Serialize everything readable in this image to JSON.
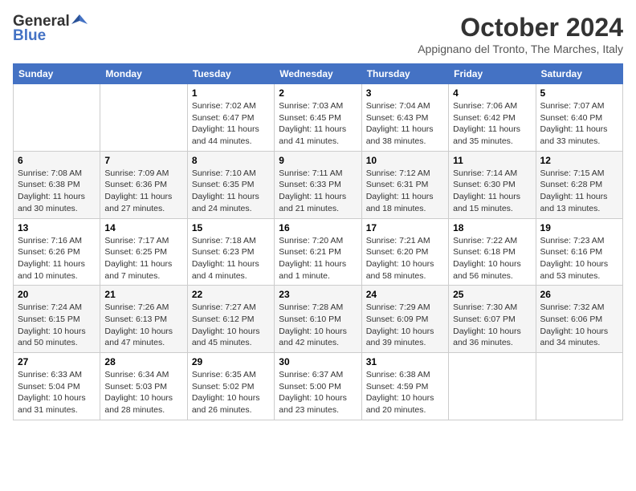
{
  "logo": {
    "general": "General",
    "blue": "Blue"
  },
  "header": {
    "month": "October 2024",
    "subtitle": "Appignano del Tronto, The Marches, Italy"
  },
  "weekdays": [
    "Sunday",
    "Monday",
    "Tuesday",
    "Wednesday",
    "Thursday",
    "Friday",
    "Saturday"
  ],
  "weeks": [
    [
      {
        "day": "",
        "info": ""
      },
      {
        "day": "",
        "info": ""
      },
      {
        "day": "1",
        "info": "Sunrise: 7:02 AM\nSunset: 6:47 PM\nDaylight: 11 hours and 44 minutes."
      },
      {
        "day": "2",
        "info": "Sunrise: 7:03 AM\nSunset: 6:45 PM\nDaylight: 11 hours and 41 minutes."
      },
      {
        "day": "3",
        "info": "Sunrise: 7:04 AM\nSunset: 6:43 PM\nDaylight: 11 hours and 38 minutes."
      },
      {
        "day": "4",
        "info": "Sunrise: 7:06 AM\nSunset: 6:42 PM\nDaylight: 11 hours and 35 minutes."
      },
      {
        "day": "5",
        "info": "Sunrise: 7:07 AM\nSunset: 6:40 PM\nDaylight: 11 hours and 33 minutes."
      }
    ],
    [
      {
        "day": "6",
        "info": "Sunrise: 7:08 AM\nSunset: 6:38 PM\nDaylight: 11 hours and 30 minutes."
      },
      {
        "day": "7",
        "info": "Sunrise: 7:09 AM\nSunset: 6:36 PM\nDaylight: 11 hours and 27 minutes."
      },
      {
        "day": "8",
        "info": "Sunrise: 7:10 AM\nSunset: 6:35 PM\nDaylight: 11 hours and 24 minutes."
      },
      {
        "day": "9",
        "info": "Sunrise: 7:11 AM\nSunset: 6:33 PM\nDaylight: 11 hours and 21 minutes."
      },
      {
        "day": "10",
        "info": "Sunrise: 7:12 AM\nSunset: 6:31 PM\nDaylight: 11 hours and 18 minutes."
      },
      {
        "day": "11",
        "info": "Sunrise: 7:14 AM\nSunset: 6:30 PM\nDaylight: 11 hours and 15 minutes."
      },
      {
        "day": "12",
        "info": "Sunrise: 7:15 AM\nSunset: 6:28 PM\nDaylight: 11 hours and 13 minutes."
      }
    ],
    [
      {
        "day": "13",
        "info": "Sunrise: 7:16 AM\nSunset: 6:26 PM\nDaylight: 11 hours and 10 minutes."
      },
      {
        "day": "14",
        "info": "Sunrise: 7:17 AM\nSunset: 6:25 PM\nDaylight: 11 hours and 7 minutes."
      },
      {
        "day": "15",
        "info": "Sunrise: 7:18 AM\nSunset: 6:23 PM\nDaylight: 11 hours and 4 minutes."
      },
      {
        "day": "16",
        "info": "Sunrise: 7:20 AM\nSunset: 6:21 PM\nDaylight: 11 hours and 1 minute."
      },
      {
        "day": "17",
        "info": "Sunrise: 7:21 AM\nSunset: 6:20 PM\nDaylight: 10 hours and 58 minutes."
      },
      {
        "day": "18",
        "info": "Sunrise: 7:22 AM\nSunset: 6:18 PM\nDaylight: 10 hours and 56 minutes."
      },
      {
        "day": "19",
        "info": "Sunrise: 7:23 AM\nSunset: 6:16 PM\nDaylight: 10 hours and 53 minutes."
      }
    ],
    [
      {
        "day": "20",
        "info": "Sunrise: 7:24 AM\nSunset: 6:15 PM\nDaylight: 10 hours and 50 minutes."
      },
      {
        "day": "21",
        "info": "Sunrise: 7:26 AM\nSunset: 6:13 PM\nDaylight: 10 hours and 47 minutes."
      },
      {
        "day": "22",
        "info": "Sunrise: 7:27 AM\nSunset: 6:12 PM\nDaylight: 10 hours and 45 minutes."
      },
      {
        "day": "23",
        "info": "Sunrise: 7:28 AM\nSunset: 6:10 PM\nDaylight: 10 hours and 42 minutes."
      },
      {
        "day": "24",
        "info": "Sunrise: 7:29 AM\nSunset: 6:09 PM\nDaylight: 10 hours and 39 minutes."
      },
      {
        "day": "25",
        "info": "Sunrise: 7:30 AM\nSunset: 6:07 PM\nDaylight: 10 hours and 36 minutes."
      },
      {
        "day": "26",
        "info": "Sunrise: 7:32 AM\nSunset: 6:06 PM\nDaylight: 10 hours and 34 minutes."
      }
    ],
    [
      {
        "day": "27",
        "info": "Sunrise: 6:33 AM\nSunset: 5:04 PM\nDaylight: 10 hours and 31 minutes."
      },
      {
        "day": "28",
        "info": "Sunrise: 6:34 AM\nSunset: 5:03 PM\nDaylight: 10 hours and 28 minutes."
      },
      {
        "day": "29",
        "info": "Sunrise: 6:35 AM\nSunset: 5:02 PM\nDaylight: 10 hours and 26 minutes."
      },
      {
        "day": "30",
        "info": "Sunrise: 6:37 AM\nSunset: 5:00 PM\nDaylight: 10 hours and 23 minutes."
      },
      {
        "day": "31",
        "info": "Sunrise: 6:38 AM\nSunset: 4:59 PM\nDaylight: 10 hours and 20 minutes."
      },
      {
        "day": "",
        "info": ""
      },
      {
        "day": "",
        "info": ""
      }
    ]
  ]
}
